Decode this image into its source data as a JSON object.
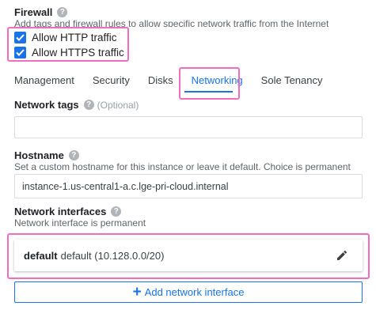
{
  "firewall": {
    "title": "Firewall",
    "help_icon": "help-icon",
    "description": "Add tags and firewall rules to allow specific network traffic from the Internet",
    "options": [
      {
        "label": "Allow HTTP traffic",
        "checked": true
      },
      {
        "label": "Allow HTTPS traffic",
        "checked": true
      }
    ]
  },
  "tabs": [
    {
      "label": "Management",
      "active": false
    },
    {
      "label": "Security",
      "active": false
    },
    {
      "label": "Disks",
      "active": false
    },
    {
      "label": "Networking",
      "active": true
    },
    {
      "label": "Sole Tenancy",
      "active": false
    }
  ],
  "network_tags": {
    "label": "Network tags",
    "optional": "(Optional)",
    "value": ""
  },
  "hostname": {
    "label": "Hostname",
    "description": "Set a custom hostname for this instance or leave it default. Choice is permanent",
    "value": "instance-1.us-central1-a.c.lge-pri-cloud.internal"
  },
  "network_interfaces": {
    "label": "Network interfaces",
    "description": "Network interface is permanent",
    "items": [
      {
        "name": "default",
        "detail": "default (10.128.0.0/20)",
        "edit_icon": "pencil-icon"
      }
    ],
    "add_button": "Add network interface",
    "add_icon": "plus-icon"
  },
  "colors": {
    "accent": "#1a73e8",
    "highlight": "#f06ec0",
    "muted_text": "#5f6368"
  }
}
